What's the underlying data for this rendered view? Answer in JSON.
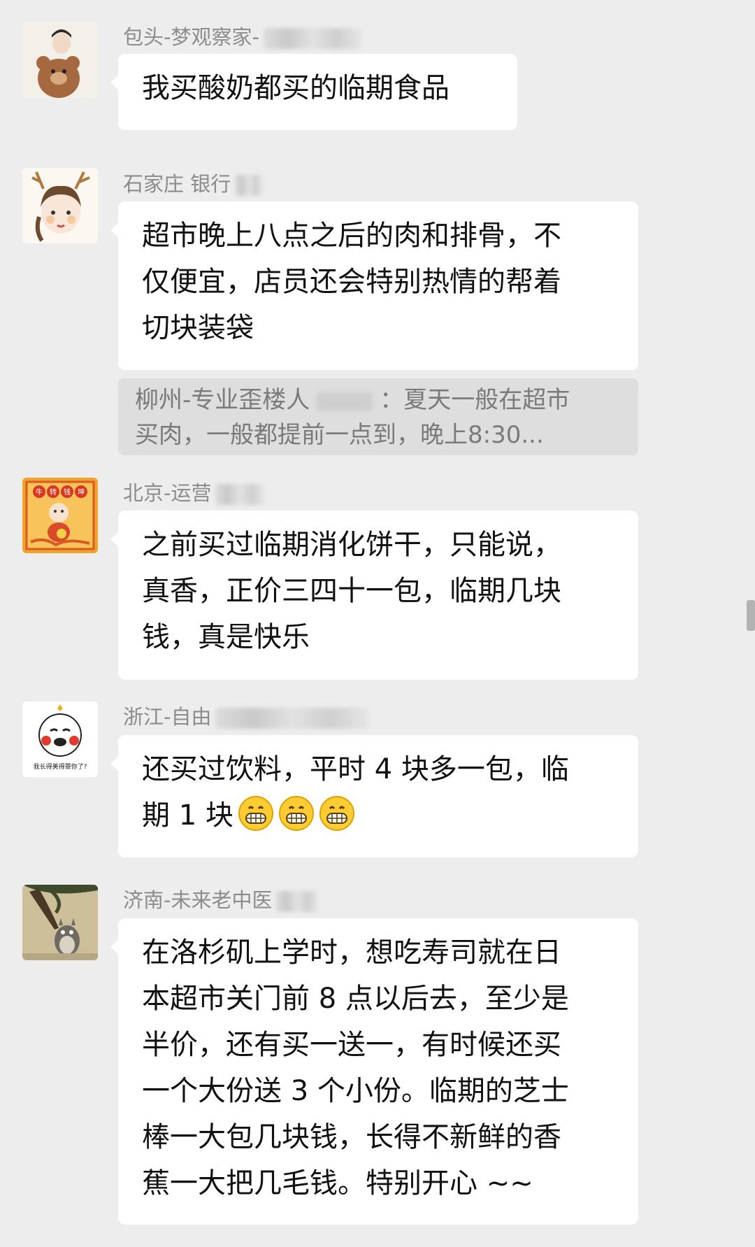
{
  "messages": [
    {
      "sender": "包头-梦观察家-",
      "avatar_icon": "girl-with-teddy-bear-avatar",
      "text_lines": [
        "我买酸奶都买的临期食品"
      ]
    },
    {
      "sender": "石家庄 银行",
      "avatar_icon": "girl-with-antlers-avatar",
      "text_lines": [
        "超市晚上八点之后的肉和排骨，不",
        "仅便宜，店员还会特别热情的帮着",
        "切块装袋"
      ],
      "quote_lines": [
        "柳州-专业歪楼人",
        "：夏天一般在超市",
        "买肉，一般都提前一点到，晚上8:30..."
      ]
    },
    {
      "sender": "北京-运营",
      "avatar_icon": "fortune-cartoon-avatar",
      "avatar_caption": "牛转钱坤",
      "text_lines": [
        "之前买过临期消化饼干，只能说，",
        "真香，正价三四十一包，临期几块",
        "钱，真是快乐"
      ]
    },
    {
      "sender": "浙江-自由",
      "avatar_icon": "meme-face-avatar",
      "avatar_caption": "我长得美得罪你了?",
      "text_lines": [
        "还买过饮料，平时 4 块多一包，临",
        "期 1 块"
      ],
      "emoji": "grinning-face-icon"
    },
    {
      "sender": "济南-未来老中医",
      "avatar_icon": "totoro-under-tree-avatar",
      "text_lines": [
        "在洛杉矶上学时，想吃寿司就在日",
        "本超市关门前 8 点以后去，至少是",
        "半价，还有买一送一，有时候还买",
        "一个大份送 3 个小份。临期的芝士",
        "棒一大包几块钱，长得不新鲜的香",
        "蕉一大把几毛钱。特别开心 ~~"
      ]
    }
  ],
  "colors": {
    "background": "#ededed",
    "bubble": "#ffffff",
    "sender": "#8c8c8c",
    "quote_bg": "#dedede"
  }
}
